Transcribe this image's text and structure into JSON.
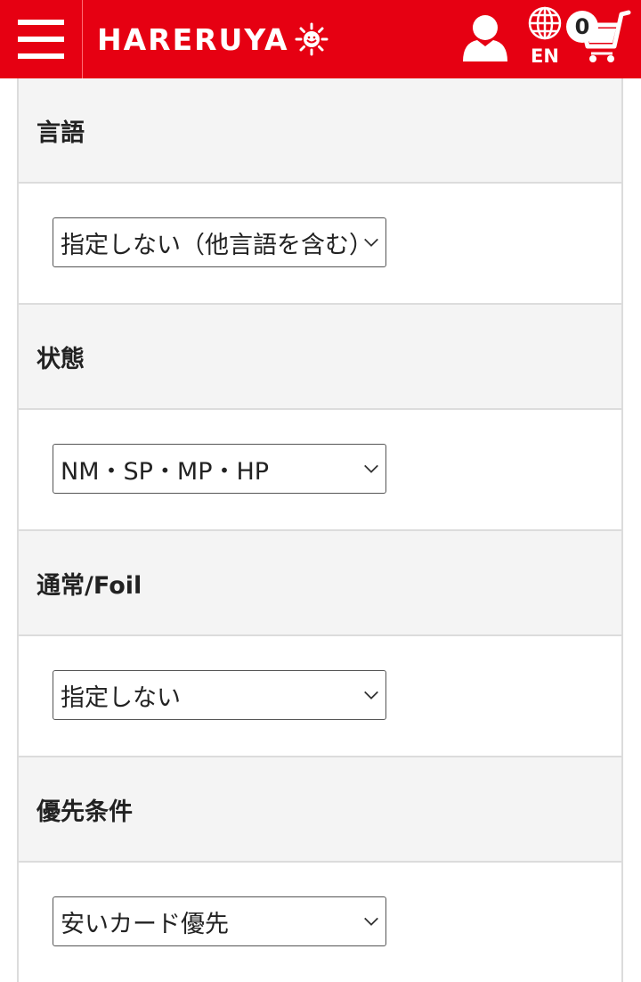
{
  "header": {
    "logo_text": "HARERUYA",
    "language_label": "EN",
    "cart_count": "0",
    "brand_color": "#e60012",
    "icons": [
      "hamburger-menu-icon",
      "hareruya-sun-icon",
      "user-icon",
      "globe-icon",
      "cart-icon"
    ]
  },
  "filters": [
    {
      "label": "言語",
      "value": "指定しない（他言語を含む）"
    },
    {
      "label": "状態",
      "value": "NM・SP・MP・HP"
    },
    {
      "label": "通常/Foil",
      "value": "指定しない"
    },
    {
      "label": "優先条件",
      "value": "安いカード優先"
    }
  ]
}
